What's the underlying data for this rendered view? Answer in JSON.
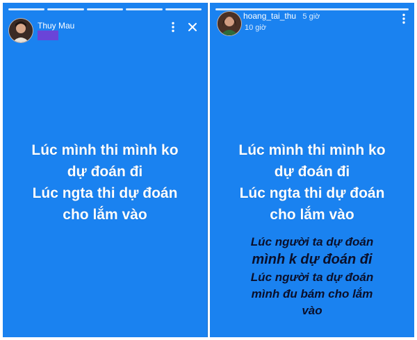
{
  "left_story": {
    "username": "Thuy Mau",
    "caption_lines": [
      "Lúc mình thi mình ko",
      "dự đoán đi",
      "Lúc ngta thi dự đoán",
      "cho lắm vào"
    ],
    "progress_segments": 5
  },
  "right_story": {
    "username": "hoang_tai_thu",
    "time_primary": "5 giờ",
    "time_secondary": "10 giờ",
    "caption_lines": [
      "Lúc mình thi mình ko",
      "dự đoán đi",
      "Lúc ngta thi dự đoán",
      "cho lắm vào"
    ],
    "reply_lines": [
      "Lúc người ta dự đoán",
      "mình k dự đoán đi",
      "Lúc người ta dự đoán",
      "mình đu bám cho lắm",
      "vào"
    ],
    "progress_segments": 1
  },
  "colors": {
    "story_background": "#1a82f0",
    "redaction": "#6a44d8",
    "reply_text": "#0a0f2a"
  },
  "icons": [
    "more-vertical-icon",
    "close-icon"
  ]
}
